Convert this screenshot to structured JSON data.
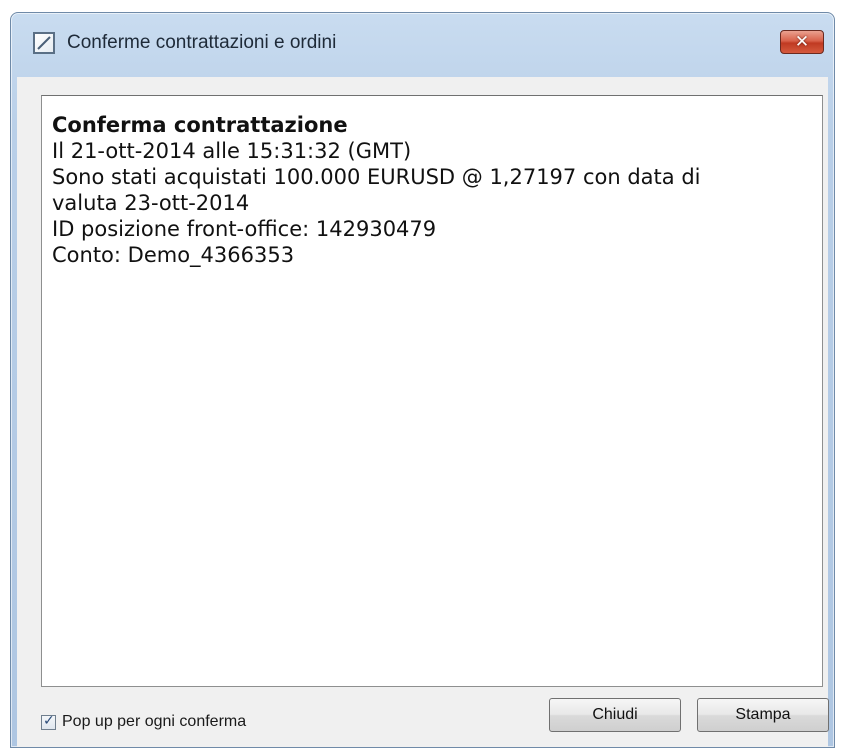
{
  "window": {
    "title": "Conferme contrattazioni e ordini",
    "close_symbol": "✕"
  },
  "message": {
    "heading": "Conferma contrattazione",
    "lines": [
      "Il 21-ott-2014 alle 15:31:32 (GMT)",
      "Sono stati acquistati 100.000 EURUSD @ 1,27197 con data di",
      "valuta 23-ott-2014",
      "ID posizione front-office: 142930479",
      "Conto: Demo_4366353"
    ]
  },
  "footer": {
    "popup_checkbox": {
      "label": "Pop up per ogni conferma",
      "checked": true,
      "check_glyph": "✓"
    },
    "close_button_label": "Chiudi",
    "print_button_label": "Stampa"
  },
  "colors": {
    "titlebar": "#b9cfe8",
    "close_button": "#c03a22",
    "client_background": "#f0f0f0"
  },
  "icons": {
    "app": "app-window-icon",
    "close": "close-icon",
    "check": "check-icon"
  }
}
